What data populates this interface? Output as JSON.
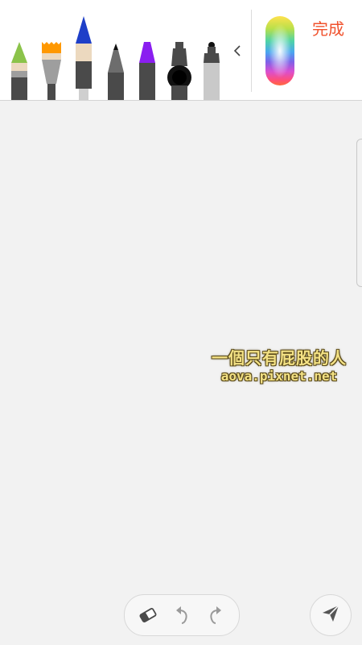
{
  "toolbar": {
    "done_label": "完成",
    "tools": [
      {
        "name": "brush-green",
        "tip_color": "#8bc34a"
      },
      {
        "name": "flat-brush-orange",
        "tip_color": "#ff9800"
      },
      {
        "name": "brush-blue",
        "tip_color": "#1e3fc8"
      },
      {
        "name": "pencil-black",
        "tip_color": "#111111"
      },
      {
        "name": "marker-purple",
        "tip_color": "#8a1ef0"
      },
      {
        "name": "fountain-pen-black",
        "tip_color": "#111111"
      },
      {
        "name": "marker-gray",
        "tip_color": "#111111"
      }
    ],
    "accent_color": "#f0522d"
  },
  "watermark": {
    "line1": "一個只有屁股的人",
    "line2": "aova.pixnet.net"
  },
  "bottom_bar": {
    "icons": [
      "eraser-icon",
      "undo-icon",
      "redo-icon"
    ],
    "send_icon": "send-icon"
  }
}
